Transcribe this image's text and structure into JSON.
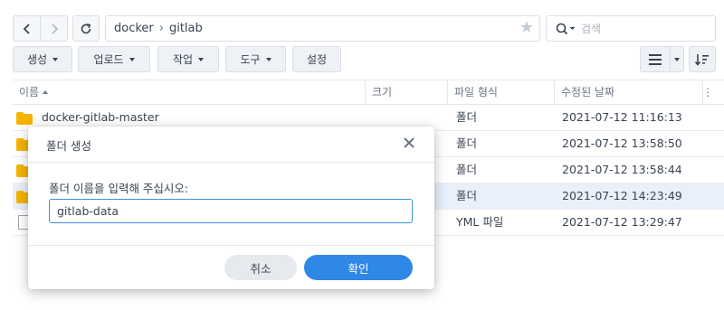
{
  "nav": {
    "back_icon": "chevron-left-icon",
    "forward_icon": "chevron-right-icon",
    "refresh_icon": "refresh-icon"
  },
  "path": {
    "segments": [
      "docker",
      "gitlab"
    ],
    "favorite_icon": "star-icon"
  },
  "search": {
    "placeholder": "검색",
    "icon": "search-icon"
  },
  "toolbar": {
    "create_label": "생성",
    "upload_label": "업로드",
    "action_label": "작업",
    "tools_label": "도구",
    "settings_label": "설정",
    "view_icon": "list-view-icon",
    "sort_icon": "sort-icon"
  },
  "table": {
    "columns": [
      "이름",
      "크기",
      "파일 형식",
      "수정된 날짜"
    ],
    "rows": [
      {
        "name": "docker-gitlab-master",
        "size": "",
        "type": "폴더",
        "modified": "2021-07-12 11:16:13",
        "icon": "folder-icon"
      },
      {
        "name": "",
        "size": "",
        "type": "폴더",
        "modified": "2021-07-12 13:58:50",
        "icon": "folder-icon"
      },
      {
        "name": "",
        "size": "",
        "type": "폴더",
        "modified": "2021-07-12 13:58:44",
        "icon": "folder-icon"
      },
      {
        "name": "",
        "size": "",
        "type": "폴더",
        "modified": "2021-07-12 14:23:49",
        "icon": "folder-icon"
      },
      {
        "name": "",
        "size": "",
        "type": "YML 파일",
        "modified": "2021-07-12 13:29:47",
        "icon": "file-icon"
      }
    ]
  },
  "dialog": {
    "title": "폴더 생성",
    "prompt": "폴더 이름을 입력해 주십시오:",
    "input_value": "gitlab-data",
    "cancel_label": "취소",
    "ok_label": "확인"
  },
  "colors": {
    "accent": "#2f87e6",
    "folder": "#f5b400",
    "selected_row": "#e8f0fb"
  }
}
